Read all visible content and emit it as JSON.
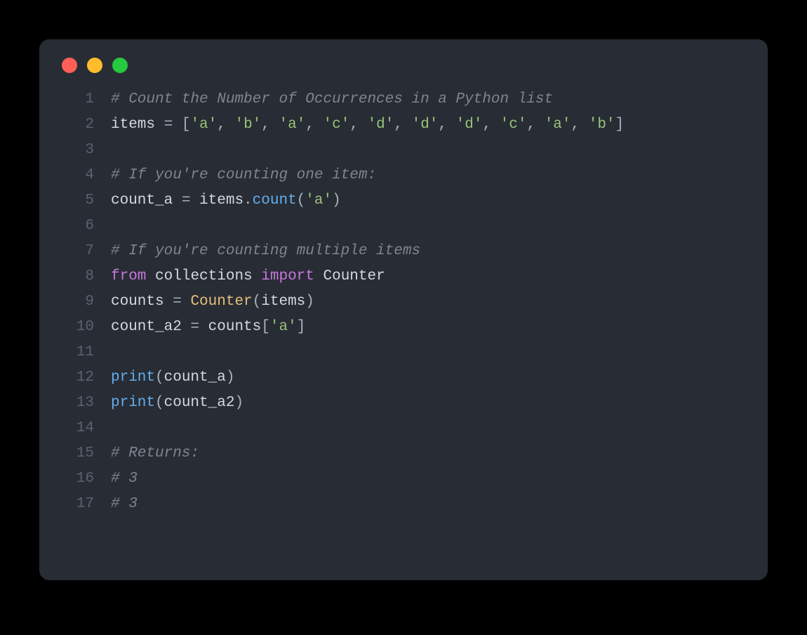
{
  "window": {
    "platform": "mac",
    "theme": "one-dark"
  },
  "traffic": {
    "close": {
      "color": "#ff5f56"
    },
    "minimize": {
      "color": "#ffbd2e"
    },
    "zoom": {
      "color": "#27c93f"
    }
  },
  "gutter": {
    "1": "1",
    "2": "2",
    "3": "3",
    "4": "4",
    "5": "5",
    "6": "6",
    "7": "7",
    "8": "8",
    "9": "9",
    "10": "10",
    "11": "11",
    "12": "12",
    "13": "13",
    "14": "14",
    "15": "15",
    "16": "16",
    "17": "17"
  },
  "code": {
    "l1_comment": "# Count the Number of Occurrences in a Python list",
    "l2_items": "items",
    "l2_eq": " = ",
    "l2_lb": "[",
    "l2_s0": "'a'",
    "l2_c0": ", ",
    "l2_s1": "'b'",
    "l2_c1": ", ",
    "l2_s2": "'a'",
    "l2_c2": ", ",
    "l2_s3": "'c'",
    "l2_c3": ", ",
    "l2_s4": "'d'",
    "l2_c4": ", ",
    "l2_s5": "'d'",
    "l2_c5": ", ",
    "l2_s6": "'d'",
    "l2_c6": ", ",
    "l2_s7": "'c'",
    "l2_c7": ", ",
    "l2_s8": "'a'",
    "l2_c8": ", ",
    "l2_s9": "'b'",
    "l2_rb": "]",
    "l3_blank": " ",
    "l4_comment": "# If you're counting one item:",
    "l5_var": "count_a",
    "l5_eq": " = ",
    "l5_obj": "items",
    "l5_dot": ".",
    "l5_func": "count",
    "l5_lp": "(",
    "l5_arg": "'a'",
    "l5_rp": ")",
    "l6_blank": " ",
    "l7_comment": "# If you're counting multiple items",
    "l8_from": "from",
    "l8_sp1": " ",
    "l8_module": "collections",
    "l8_sp2": " ",
    "l8_import": "import",
    "l8_sp3": " ",
    "l8_name": "Counter",
    "l9_var": "counts",
    "l9_eq": " = ",
    "l9_cls": "Counter",
    "l9_lp": "(",
    "l9_arg": "items",
    "l9_rp": ")",
    "l10_var": "count_a2",
    "l10_eq": " = ",
    "l10_obj": "counts",
    "l10_lb": "[",
    "l10_key": "'a'",
    "l10_rb": "]",
    "l11_blank": " ",
    "l12_fn": "print",
    "l12_lp": "(",
    "l12_arg": "count_a",
    "l12_rp": ")",
    "l13_fn": "print",
    "l13_lp": "(",
    "l13_arg": "count_a2",
    "l13_rp": ")",
    "l14_blank": " ",
    "l15_comment": "# Returns:",
    "l16_comment": "# 3",
    "l17_comment": "# 3"
  }
}
